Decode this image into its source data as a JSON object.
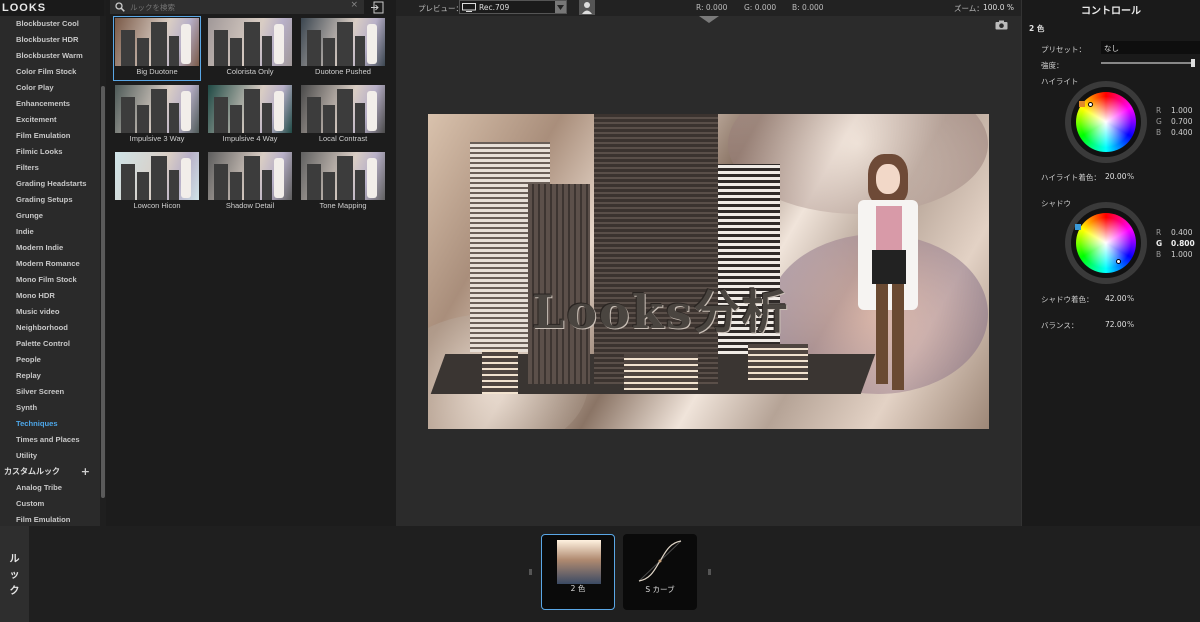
{
  "app": {
    "logo": "LOOKS"
  },
  "categories": {
    "items": [
      {
        "label": "Blockbuster Cool"
      },
      {
        "label": "Blockbuster HDR"
      },
      {
        "label": "Blockbuster Warm"
      },
      {
        "label": "Color Film Stock"
      },
      {
        "label": "Color Play"
      },
      {
        "label": "Enhancements"
      },
      {
        "label": "Excitement"
      },
      {
        "label": "Film Emulation"
      },
      {
        "label": "Filmic Looks"
      },
      {
        "label": "Filters"
      },
      {
        "label": "Grading Headstarts"
      },
      {
        "label": "Grading Setups"
      },
      {
        "label": "Grunge"
      },
      {
        "label": "Indie"
      },
      {
        "label": "Modern Indie"
      },
      {
        "label": "Modern Romance"
      },
      {
        "label": "Mono Film Stock"
      },
      {
        "label": "Mono HDR"
      },
      {
        "label": "Music video"
      },
      {
        "label": "Neighborhood"
      },
      {
        "label": "Palette Control"
      },
      {
        "label": "People"
      },
      {
        "label": "Replay"
      },
      {
        "label": "Silver Screen"
      },
      {
        "label": "Synth"
      },
      {
        "label": "Techniques"
      },
      {
        "label": "Times and Places"
      },
      {
        "label": "Utility"
      }
    ],
    "active": "Techniques",
    "custom_header": "カスタムルック",
    "custom_add": "+",
    "custom_items": [
      {
        "label": "Analog Tribe"
      },
      {
        "label": "Custom"
      },
      {
        "label": "Film Emulation"
      }
    ]
  },
  "search": {
    "placeholder": "ルックを検索",
    "clear": "×"
  },
  "looks": [
    {
      "label": "Big Duotone",
      "selected": true,
      "tint": "#7a5a48"
    },
    {
      "label": "Colorista Only",
      "tint": "#a09898"
    },
    {
      "label": "Duotone Pushed",
      "tint": "#3b4650"
    },
    {
      "label": "Impulsive 3 Way",
      "tint": "#4e5a58"
    },
    {
      "label": "Impulsive 4 Way",
      "tint": "#1f4a45"
    },
    {
      "label": "Local Contrast",
      "tint": "#4a4a4a"
    },
    {
      "label": "Lowcon Hicon",
      "tint": "#cfe4e8"
    },
    {
      "label": "Shadow Detail",
      "tint": "#5d5d5d"
    },
    {
      "label": "Tone Mapping",
      "tint": "#606060"
    }
  ],
  "topbar": {
    "preview_label": "プレビュー：",
    "preview_value": "Rec.709",
    "r": "R: 0.000",
    "g": "G: 0.000",
    "b": "B: 0.000",
    "zoom_label": "ズーム：",
    "zoom_value": "100.0 %"
  },
  "preview": {
    "overlay_title": "Looks分析"
  },
  "controls": {
    "title": "コントロール",
    "tool_name": "2 色",
    "preset_label": "プリセット：",
    "preset_value": "なし",
    "strength_label": "強度：",
    "strength_value": 1.0,
    "highlight": {
      "label": "ハイライト",
      "r_label": "R",
      "r": "1.000",
      "g_label": "G",
      "g": "0.700",
      "b_label": "B",
      "b": "0.400",
      "amount_label": "ハイライト着色：",
      "amount": "20.00",
      "unit": "%"
    },
    "shadow": {
      "label": "シャドウ",
      "r_label": "R",
      "r": "0.400",
      "g_label": "G",
      "g": "0.800",
      "b_label": "B",
      "b": "1.000",
      "amount_label": "シャドウ着色：",
      "amount": "42.00",
      "unit": "%"
    },
    "balance_label": "バランス：",
    "balance": "72.00",
    "balance_unit": "%"
  },
  "bottom": {
    "tab_label_1": "ル",
    "tab_label_2": "ッ",
    "tab_label_3": "ク",
    "tools": [
      {
        "label": "2 色",
        "selected": true
      },
      {
        "label": "S カーブ"
      }
    ]
  },
  "colors": {
    "accent": "#5aa7e6",
    "active_category": "#4da6e8"
  }
}
